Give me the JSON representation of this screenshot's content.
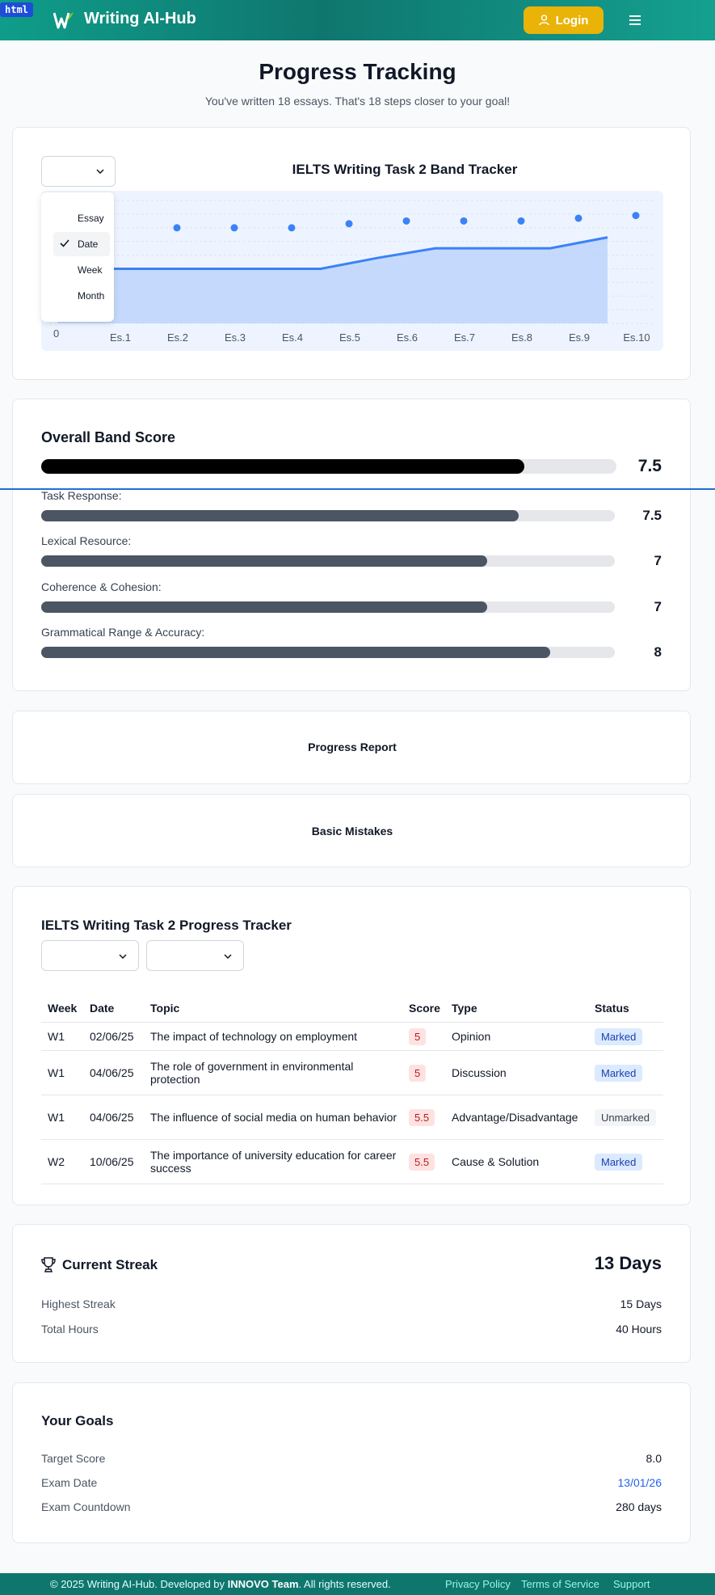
{
  "badge": "html",
  "header": {
    "brand": "Writing AI-Hub",
    "login_label": "Login"
  },
  "page": {
    "title": "Progress Tracking",
    "subtitle": "You've written 18 essays. That's 18 steps closer to your goal!"
  },
  "chart_data": {
    "type": "line",
    "title": "IELTS Writing Task 2 Band Tracker",
    "categories": [
      "Es.1",
      "Es.2",
      "Es.3",
      "Es.4",
      "Es.5",
      "Es.6",
      "Es.7",
      "Es.8",
      "Es.9",
      "Es.10"
    ],
    "y_tick_visible": "0",
    "series": [
      {
        "kind": "points",
        "values": [
          7.0,
          7.0,
          7.0,
          7.0,
          7.3,
          7.5,
          7.5,
          7.5,
          7.7,
          7.9
        ]
      },
      {
        "kind": "area",
        "values": [
          4.0,
          4.0,
          4.0,
          4.0,
          4.8,
          5.5,
          5.5,
          5.5,
          6.3,
          7.0
        ]
      }
    ],
    "ylim": [
      0,
      9
    ],
    "grid": true,
    "colors": {
      "line": "#3b82f6",
      "area": "#bcd3fb",
      "points": "#3b82f6"
    }
  },
  "chart_filter": {
    "options": [
      "Essay",
      "Date",
      "Week",
      "Month"
    ],
    "selected": "Date"
  },
  "band": {
    "heading": "Overall Band Score",
    "overall": {
      "value": "7.5",
      "fraction": 0.84
    },
    "criteria": [
      {
        "label": "Task Response:",
        "value": "7.5",
        "fraction": 0.833
      },
      {
        "label": "Lexical Resource:",
        "value": "7",
        "fraction": 0.777
      },
      {
        "label": "Coherence & Cohesion:",
        "value": "7",
        "fraction": 0.777
      },
      {
        "label": "Grammatical Range & Accuracy:",
        "value": "8",
        "fraction": 0.888
      }
    ]
  },
  "progress_report": {
    "label": "Progress Report"
  },
  "basic_mistakes": {
    "label": "Basic Mistakes"
  },
  "tracker": {
    "heading": "IELTS Writing Task 2 Progress Tracker",
    "columns": [
      "Week",
      "Date",
      "Topic",
      "Score",
      "Type",
      "Status"
    ],
    "rows": [
      {
        "week": "W1",
        "date": "02/06/25",
        "topic": "The impact of technology on employment",
        "score": "5",
        "type": "Opinion",
        "status": "Marked"
      },
      {
        "week": "W1",
        "date": "04/06/25",
        "topic": "The role of government in environmental protection",
        "score": "5",
        "type": "Discussion",
        "status": "Marked"
      },
      {
        "week": "W1",
        "date": "04/06/25",
        "topic": "The influence of social media on human behavior",
        "score": "5.5",
        "type": "Advantage/Disadvantage",
        "status": "Unmarked"
      },
      {
        "week": "W2",
        "date": "10/06/25",
        "topic": "The importance of university education for career success",
        "score": "5.5",
        "type": "Cause & Solution",
        "status": "Marked"
      }
    ]
  },
  "streak": {
    "heading": "Current Streak",
    "current": "13 Days",
    "highest_label": "Highest Streak",
    "highest": "15 Days",
    "hours_label": "Total Hours",
    "hours": "40 Hours"
  },
  "goals": {
    "heading": "Your Goals",
    "target_label": "Target Score",
    "target": "8.0",
    "exam_label": "Exam Date",
    "exam": "13/01/26",
    "countdown_label": "Exam Countdown",
    "countdown": "280 days"
  },
  "footer": {
    "copy_pre": "© 2025 Writing AI-Hub. Developed by",
    "team": "INNOVO Team",
    "copy_post": ". All rights reserved.",
    "links": [
      "Privacy Policy",
      "Terms of Service",
      "Support"
    ]
  }
}
